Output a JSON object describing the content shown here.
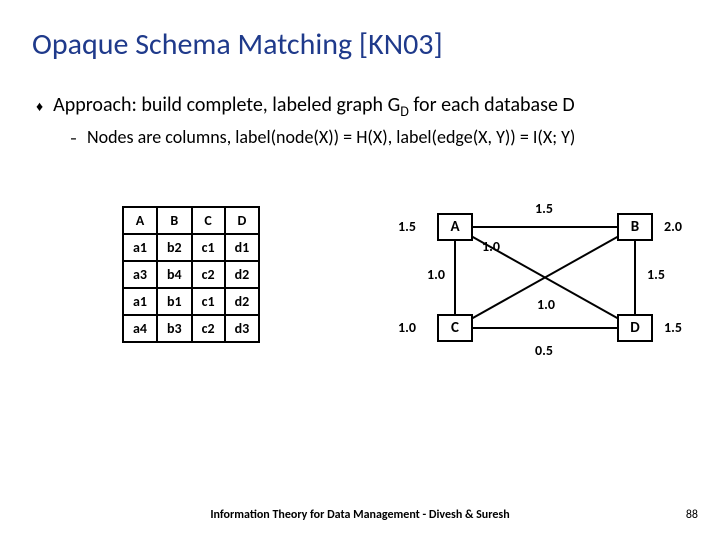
{
  "title": "Opaque Schema Matching [KN03]",
  "bullets": {
    "b1_prefix": "Approach: build complete, labeled graph G",
    "b1_sub": "D",
    "b1_suffix": " for each database D",
    "b2": "Nodes are columns, label(node(X)) = H(X), label(edge(X, Y)) = I(X; Y)"
  },
  "table": {
    "headers": [
      "A",
      "B",
      "C",
      "D"
    ],
    "rows": [
      [
        "a1",
        "b2",
        "c1",
        "d1"
      ],
      [
        "a3",
        "b4",
        "c2",
        "d2"
      ],
      [
        "a1",
        "b1",
        "c1",
        "d2"
      ],
      [
        "a4",
        "b3",
        "c2",
        "d3"
      ]
    ]
  },
  "graph": {
    "nodes": {
      "A": "A",
      "B": "B",
      "C": "C",
      "D": "D"
    },
    "edge_labels": {
      "left_A": "1.5",
      "top_AB": "1.5",
      "right_B": "2.0",
      "AC": "1.0",
      "diag": "1.0",
      "BD": "1.5",
      "left_C": "1.0",
      "right_D": "1.5",
      "bottom_CD": "0.5",
      "diag2": "1.0"
    }
  },
  "chart_data": {
    "type": "table",
    "note": "Complete labeled graph G_D with 4 nodes A,B,C,D. Node labels H(X) and edge labels I(X;Y).",
    "node_labels": {
      "A": 1.5,
      "B": 2.0,
      "C": 1.0,
      "D": 1.5
    },
    "edge_labels": {
      "A-B": 1.5,
      "A-C": 1.0,
      "A-D": 1.0,
      "B-C": 1.0,
      "B-D": 1.5,
      "C-D": 0.5
    }
  },
  "footer": "Information Theory for Data Management - Divesh & Suresh",
  "page_number": "88"
}
